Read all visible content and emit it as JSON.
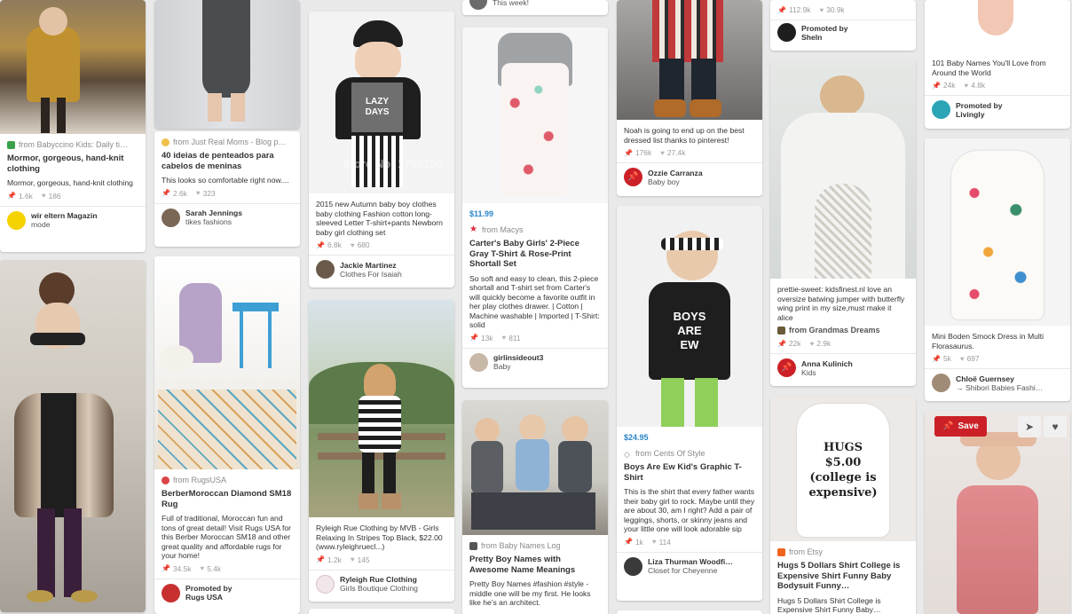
{
  "pins": {
    "p1": {
      "source": "from Babyccino Kids: Daily ti…",
      "title": "Mormor, gorgeous, hand-knit clothing",
      "desc": "Mormor, gorgeous, hand-knit clothing",
      "repins": "1.6k",
      "likes": "186",
      "user": "wir eltern Magazin",
      "board": "mode"
    },
    "p2": {},
    "p3": {
      "source": "from Just Real Moms - Blog p…",
      "title": "40 ideias de penteados para cabelos de meninas",
      "desc": "This looks so comfortable right now....",
      "repins": "2.6k",
      "likes": "323",
      "user": "Sarah Jennings",
      "board": "tikes fashions"
    },
    "p4": {
      "source": "from RugsUSA",
      "title": "BerberMoroccan Diamond SM18 Rug",
      "desc": "Full of traditional, Moroccan fun and tons of great detail! Visit Rugs USA for this Berber Moroccan SM18 and other great quality and affordable rugs for your home!",
      "repins": "34.5k",
      "likes": "5.4k",
      "promoted_label": "Promoted by",
      "user": "Rugs USA"
    },
    "p5": {
      "watermark": "Store No: 1763730",
      "shirt_text": "LAZY DAYS",
      "desc": "2015 new Autumn baby boy clothes baby clothing Fashion cotton long-sleeved Letter T-shirt+pants Newborn baby girl clothing set",
      "repins": "6.8k",
      "likes": "680",
      "user": "Jackie Martinez",
      "board": "Clothes For Isaiah"
    },
    "p6": {
      "desc": "Ryleigh Rue Clothing by MVB - Girls Relaxing In Stripes Top Black, $22.00 (www.ryleighruecl...)",
      "repins": "1.2k",
      "likes": "145",
      "user": "Ryleigh Rue Clothing",
      "board": "Girls Boutique Clothing"
    },
    "p7": {
      "desc": "This week!"
    },
    "p8": {
      "price": "$11.99",
      "source": "from Macys",
      "title": "Carter's Baby Girls' 2-Piece Gray T-Shirt & Rose-Print Shortall Set",
      "desc": "So soft and easy to clean, this 2-piece shortall and T-shirt set from Carter's will quickly become a favorite outfit in her play clothes drawer. | Cotton | Machine washable | Imported | T-Shirt: solid",
      "repins": "13k",
      "likes": "811",
      "user": "girlinsideout3",
      "board": "Baby"
    },
    "p9": {
      "source": "from Baby Names Log",
      "title": "Pretty Boy Names with Awesome Name Meanings",
      "desc": "Pretty Boy Names #fashion #style - middle one will be my first. He looks like he's an architect."
    },
    "p10": {
      "desc": "Noah is going to end up on the best dressed list thanks to pinterest!",
      "repins": "176k",
      "likes": "27.4k",
      "user": "Ozzie Carranza",
      "board": "Baby boy"
    },
    "p11": {
      "shirt_text": "BOYS ARE EW",
      "price": "$24.95",
      "source": "from Cents Of Style",
      "title": "Boys Are Ew Kid's Graphic T-Shirt",
      "desc": "This is the shirt that every father wants their baby girl to rock. Maybe until they are about 30, am I right? Add a pair of leggings, shorts, or skinny jeans and your little one will look adorable sip",
      "repins": "1k",
      "likes": "114",
      "user": "Liza Thurman Woodfi…",
      "board": "Closet for Cheyenne"
    },
    "p12": {
      "repins": "112.9k",
      "likes": "30.9k",
      "promoted_label": "Promoted by",
      "user": "Sheln"
    },
    "p13": {
      "desc": "prettie-sweet: kidsfinest.nl love an oversize batwing jumper with butterfly wing print in my size,must make it alice",
      "source": "from Grandmas Dreams",
      "repins": "22k",
      "likes": "2.9k",
      "user": "Anna Kulinich",
      "board": "Kids"
    },
    "p14": {
      "onesie_text": "HUGS $5.00 (college is expensive)",
      "source": "from Etsy",
      "title": "Hugs 5 Dollars Shirt College is Expensive Shirt Funny Baby Bodysuit Funny…",
      "desc": "Hugs 5 Dollars Shirt College is Expensive Shirt Funny Baby…"
    },
    "p15": {
      "desc": "101 Baby Names You'll Love from Around the World",
      "repins": "24k",
      "likes": "4.8k",
      "promoted_label": "Promoted by",
      "user": "Livingly"
    },
    "p16": {
      "desc": "Mini Boden Smock Dress in Multi Florasaurus.",
      "repins": "5k",
      "likes": "697",
      "user": "Chloë Guernsey",
      "board": "→ Shibori Babies Fashi…"
    },
    "p17": {
      "save_label": "Save"
    }
  },
  "icons": {
    "repin": "pin-icon",
    "like": "heart-icon",
    "send": "send-icon",
    "pinit": "pushpin-icon"
  }
}
